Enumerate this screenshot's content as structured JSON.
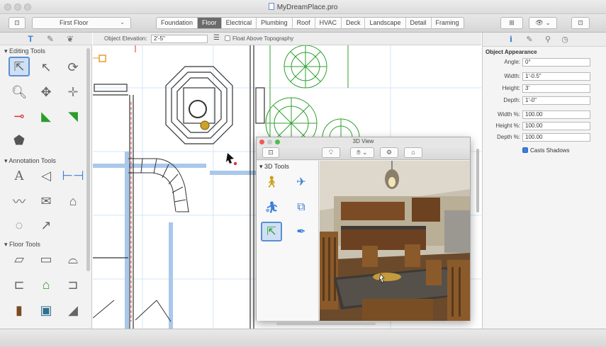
{
  "window": {
    "title": "MyDreamPlace.pro"
  },
  "toolbar": {
    "floor_select": "First Floor",
    "tabs": [
      "Foundation",
      "Floor",
      "Electrical",
      "Plumbing",
      "Roof",
      "HVAC",
      "Deck",
      "Landscape",
      "Detail",
      "Framing"
    ],
    "active_tab": "Floor"
  },
  "left_panel": {
    "sections": [
      "Editing Tools",
      "Annotation Tools",
      "Floor Tools"
    ]
  },
  "options_bar": {
    "elevation_label": "Object Elevation:",
    "elevation_value": "2'-5\"",
    "float_label": "Float Above Topography",
    "float_checked": false
  },
  "inspector": {
    "heading": "Object Appearance",
    "fields": [
      {
        "label": "Angle:",
        "value": "0°"
      },
      {
        "label": "Width:",
        "value": "1'-0.5\""
      },
      {
        "label": "Height:",
        "value": "3'"
      },
      {
        "label": "Depth:",
        "value": "1'-0\""
      },
      {
        "label": "Width %:",
        "value": "100.00"
      },
      {
        "label": "Height %:",
        "value": "100.00"
      },
      {
        "label": "Depth %:",
        "value": "100.00"
      }
    ],
    "casts_shadows_label": "Casts Shadows",
    "casts_shadows_checked": true
  },
  "view3d": {
    "title": "3D View",
    "section": "3D Tools"
  },
  "colors": {
    "accent": "#3b7fd9",
    "plan_green": "#2ca02c",
    "plan_blue": "#a9c8ea"
  }
}
